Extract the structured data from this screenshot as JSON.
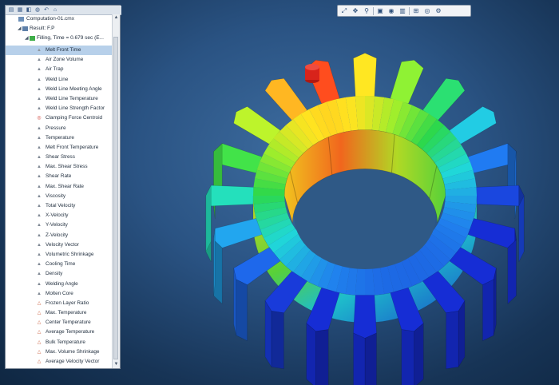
{
  "tree": {
    "file": "Computation-01.cmx",
    "result": "Result: F.P",
    "filling": "Filling, Time = 0.679 sec (E...",
    "items": [
      {
        "label": "Melt Front Time",
        "icon": "triangle",
        "color": "#8f969e",
        "selected": true
      },
      {
        "label": "Air Zone Volume",
        "icon": "triangle",
        "color": "#7d8692",
        "selected": false
      },
      {
        "label": "Air Trap",
        "icon": "triangle",
        "color": "#7d8692",
        "selected": false
      },
      {
        "label": "Weld Line",
        "icon": "triangle",
        "color": "#7d8692",
        "selected": false
      },
      {
        "label": "Weld Line Meeting Angle",
        "icon": "triangle",
        "color": "#7d8692",
        "selected": false
      },
      {
        "label": "Weld Line Temperature",
        "icon": "triangle",
        "color": "#7d8692",
        "selected": false
      },
      {
        "label": "Weld Line Strength Factor",
        "icon": "triangle",
        "color": "#7d8692",
        "selected": false
      },
      {
        "label": "Clamping Force Centroid",
        "icon": "target",
        "color": "#d0433a",
        "selected": false
      },
      {
        "label": "Pressure",
        "icon": "triangle",
        "color": "#7d8692",
        "selected": false
      },
      {
        "label": "Temperature",
        "icon": "triangle",
        "color": "#7d8692",
        "selected": false
      },
      {
        "label": "Melt Front Temperature",
        "icon": "triangle",
        "color": "#7d8692",
        "selected": false
      },
      {
        "label": "Shear Stress",
        "icon": "triangle",
        "color": "#7d8692",
        "selected": false
      },
      {
        "label": "Max. Shear Stress",
        "icon": "triangle",
        "color": "#7d8692",
        "selected": false
      },
      {
        "label": "Shear Rate",
        "icon": "triangle",
        "color": "#7d8692",
        "selected": false
      },
      {
        "label": "Max. Shear Rate",
        "icon": "triangle",
        "color": "#7d8692",
        "selected": false
      },
      {
        "label": "Viscosity",
        "icon": "triangle",
        "color": "#7d8692",
        "selected": false
      },
      {
        "label": "Total Velocity",
        "icon": "triangle",
        "color": "#7d8692",
        "selected": false
      },
      {
        "label": "X-Velocity",
        "icon": "triangle",
        "color": "#7d8692",
        "selected": false
      },
      {
        "label": "Y-Velocity",
        "icon": "triangle",
        "color": "#7d8692",
        "selected": false
      },
      {
        "label": "Z-Velocity",
        "icon": "triangle",
        "color": "#7d8692",
        "selected": false
      },
      {
        "label": "Velocity Vector",
        "icon": "triangle",
        "color": "#7d8692",
        "selected": false
      },
      {
        "label": "Volumetric Shrinkage",
        "icon": "triangle",
        "color": "#7d8692",
        "selected": false
      },
      {
        "label": "Cooling Time",
        "icon": "triangle",
        "color": "#7d8692",
        "selected": false
      },
      {
        "label": "Density",
        "icon": "triangle",
        "color": "#7d8692",
        "selected": false
      },
      {
        "label": "Welding Angle",
        "icon": "triangle",
        "color": "#7d8692",
        "selected": false
      },
      {
        "label": "Molten Core",
        "icon": "triangle",
        "color": "#7d8692",
        "selected": false
      },
      {
        "label": "Frozen Layer Ratio",
        "icon": "triangle-outline",
        "color": "#d06a4a",
        "selected": false
      },
      {
        "label": "Max. Temperature",
        "icon": "triangle-outline",
        "color": "#d06a4a",
        "selected": false
      },
      {
        "label": "Center Temperature",
        "icon": "triangle-outline",
        "color": "#d06a4a",
        "selected": false
      },
      {
        "label": "Average Temperature",
        "icon": "triangle-outline",
        "color": "#d06a4a",
        "selected": false
      },
      {
        "label": "Bulk Temperature",
        "icon": "triangle-outline",
        "color": "#d06a4a",
        "selected": false
      },
      {
        "label": "Max. Volume Shrinkage",
        "icon": "triangle-outline",
        "color": "#d06a4a",
        "selected": false
      },
      {
        "label": "Average Velocity Vector",
        "icon": "triangle-outline",
        "color": "#d06a4a",
        "selected": false
      }
    ]
  },
  "tree_toolbar": [
    {
      "name": "tree-tool-1-icon",
      "glyph": "▤"
    },
    {
      "name": "tree-tool-2-icon",
      "glyph": "▦"
    },
    {
      "name": "tree-tool-3-icon",
      "glyph": "◧"
    },
    {
      "name": "tree-tool-4-icon",
      "glyph": "◍"
    },
    {
      "name": "tree-tool-5-icon",
      "glyph": "↶"
    },
    {
      "name": "tree-tool-6-icon",
      "glyph": "⌂"
    }
  ],
  "view_toolbar": [
    {
      "name": "fit-view-icon",
      "glyph": "⤢"
    },
    {
      "name": "move-view-icon",
      "glyph": "✥"
    },
    {
      "name": "zoom-icon",
      "glyph": "⚲"
    },
    {
      "name": "view-cube-icon",
      "glyph": "▣"
    },
    {
      "name": "display-mode-icon",
      "glyph": "◉"
    },
    {
      "name": "clip-plane-icon",
      "glyph": "▥"
    },
    {
      "name": "measure-icon",
      "glyph": "⊞"
    },
    {
      "name": "visibility-eye-icon",
      "glyph": "◎"
    },
    {
      "name": "settings-icon",
      "glyph": "⚙"
    }
  ],
  "colors": {
    "background": "#2a5383",
    "selection": "#b7d0ea",
    "gate_marker": "#d8231b"
  },
  "gear": {
    "teeth": 20,
    "gate_marker": "red-cylinder"
  }
}
